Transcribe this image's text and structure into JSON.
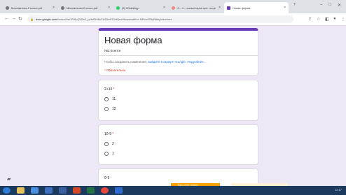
{
  "browser": {
    "tabs": [
      {
        "label": "Математика-2 класс.pdf",
        "favicon_color": "#6c757d"
      },
      {
        "label": "Математика-2 класс.pdf",
        "favicon_color": "#6c757d"
      },
      {
        "label": "(6) WhatsApp",
        "favicon_color": "#25d366"
      },
      {
        "label": "2 – 4 – сыныптарға арн...кеңе",
        "favicon_color": "#f28b82"
      },
      {
        "label": "Новая форма",
        "favicon_color": "#673ab7"
      }
    ],
    "new_tab_symbol": "+",
    "close_symbol": "×",
    "address_domain": "docs.google.com",
    "address_rest": "/forms/d/e/1FAIpQLSeF_pHwDH8bCHZ0wPChdQmt4AcewodbUo-NEvxd3I3yR6bg/viewform"
  },
  "form": {
    "title": "Новая форма",
    "description": "№2 Есепте",
    "notice_prefix": "Чтобы сохранить изменения,",
    "notice_link": "войдите в аккаунт Google.",
    "notice_more": "Подробнее...",
    "required_label": "* Обязательно",
    "questions": [
      {
        "title": "2+10",
        "required_mark": "*",
        "options": [
          "11",
          "12"
        ]
      },
      {
        "title": "10-9",
        "required_mark": "*",
        "options": [
          "2",
          "1"
        ]
      },
      {
        "title": "9-9",
        "required_mark": "",
        "options": []
      }
    ]
  },
  "toast": {
    "text": "Ваш ответ принят"
  },
  "tray": {
    "time": "12:17"
  },
  "colors": {
    "accent": "#673ab7",
    "link": "#1a73e8",
    "required": "#d93025",
    "background": "#ede7f6"
  }
}
